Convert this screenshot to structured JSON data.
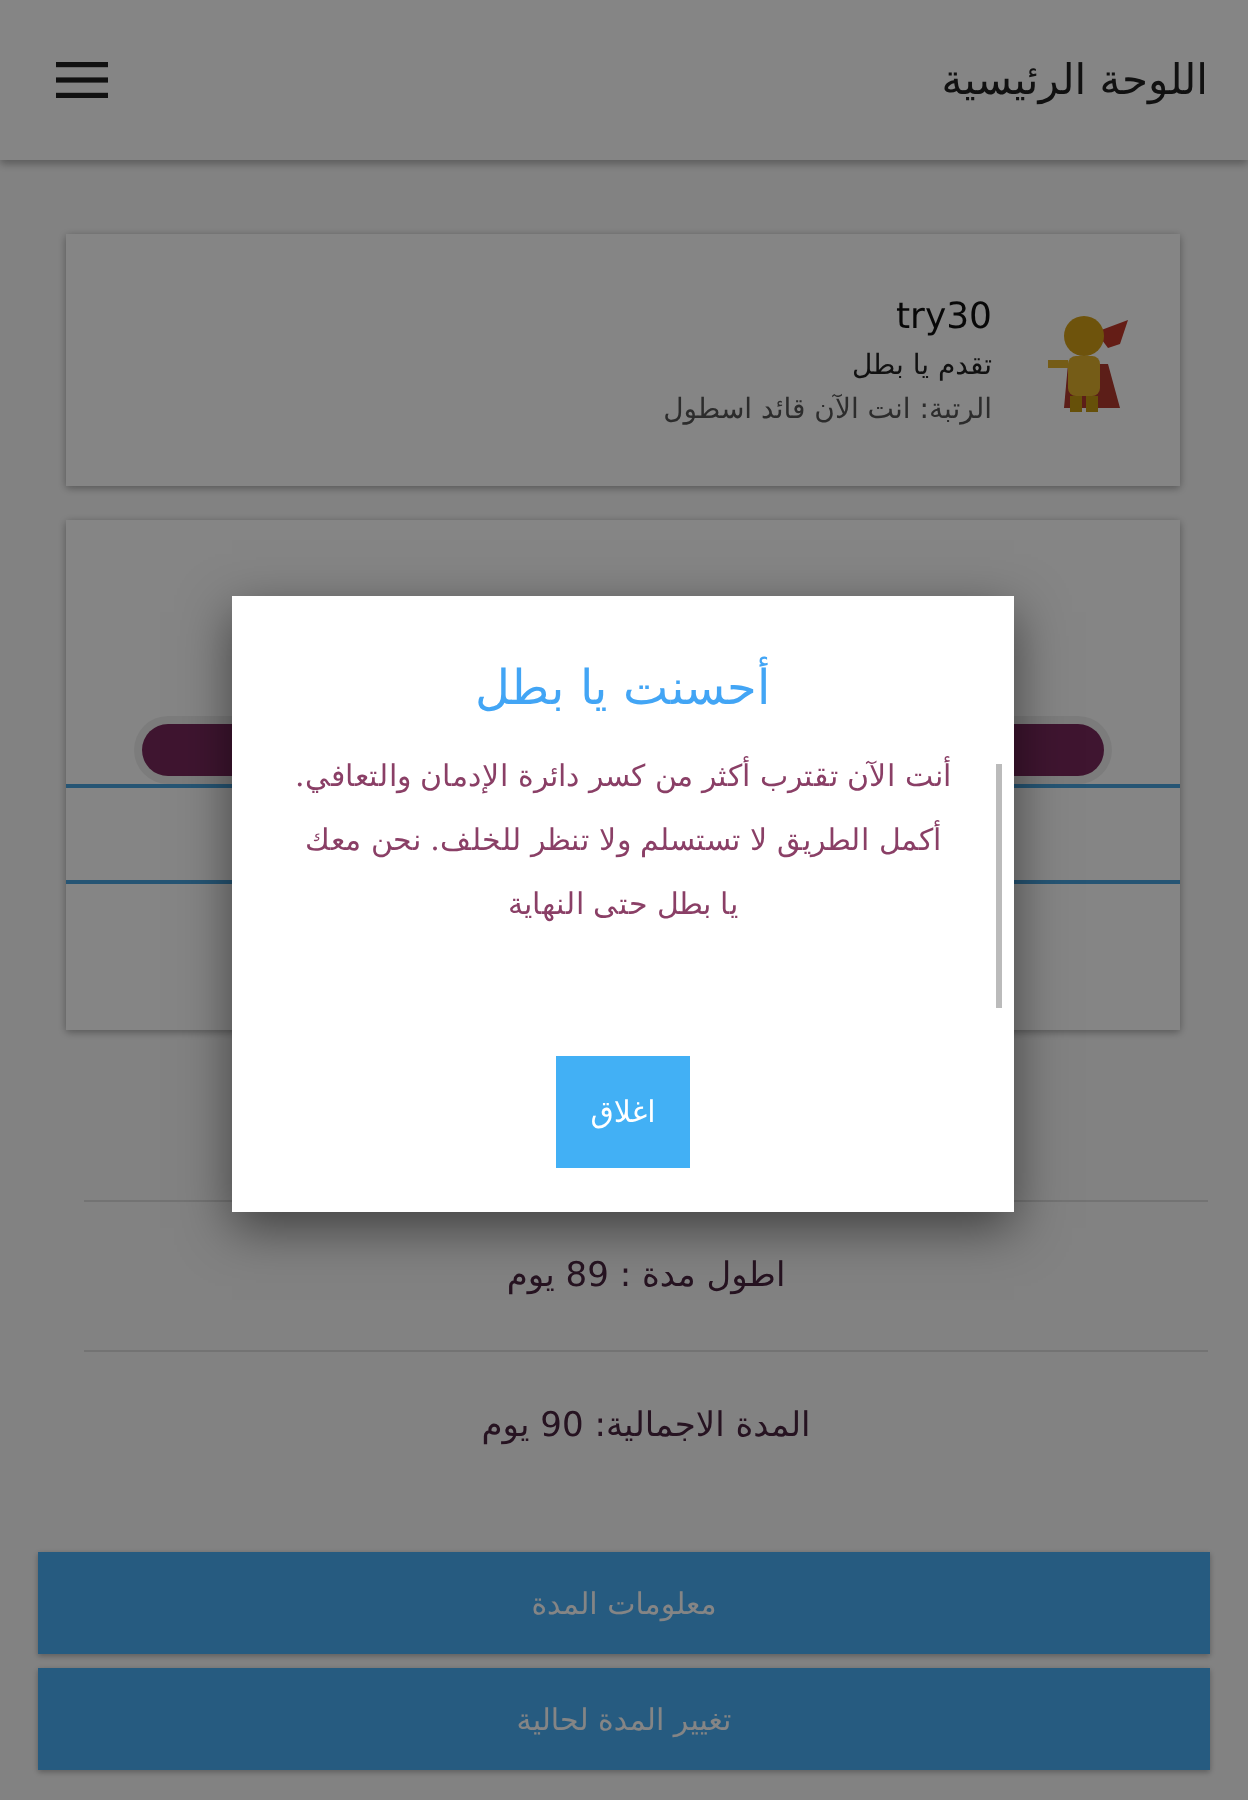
{
  "app_bar": {
    "title": "اللوحة الرئيسية"
  },
  "profile": {
    "username": "try30",
    "motto": "تقدم يا بطل",
    "rank": "الرتبة: انت الآن قائد اسطول"
  },
  "progress": {
    "level": 1
  },
  "stats": [
    "اطول مدة : 89 يوم",
    "المدة الاجمالية: 90 يوم"
  ],
  "buttons": [
    "معلومات المدة",
    "تغيير المدة لحالية"
  ],
  "dialog": {
    "title": "أحسنت يا بطل",
    "message": "أنت الآن تقترب أكثر من كسر دائرة الإدمان والتعافي. أكمل الطريق لا تستسلم ولا تنظر للخلف. نحن معك يا بطل حتى النهاية",
    "button": "اغلاق"
  }
}
